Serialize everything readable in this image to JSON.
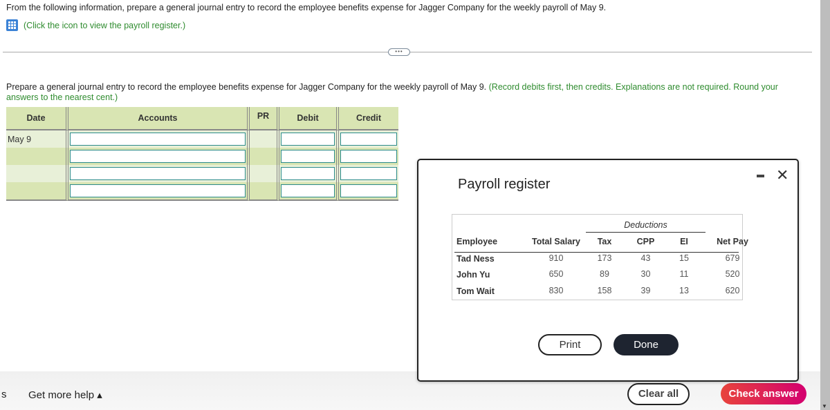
{
  "question": {
    "intro": "From the following information, prepare a general journal entry to record the employee benefits expense for Jagger Company for the weekly payroll of May 9.",
    "register_link": "(Click the icon to view the payroll register.)",
    "more_label": "•••",
    "prompt": "Prepare a general journal entry to record the employee benefits expense for Jagger Company for the weekly payroll of May 9.",
    "instructions": "(Record debits first, then credits. Explanations are not required. Round your answers to the nearest cent.)"
  },
  "journal": {
    "headers": {
      "date": "Date",
      "accounts": "Accounts",
      "pr": "PR",
      "debit": "Debit",
      "credit": "Credit"
    },
    "rows": [
      {
        "date": "May 9",
        "account": "",
        "debit": "",
        "credit": ""
      },
      {
        "date": "",
        "account": "",
        "debit": "",
        "credit": ""
      },
      {
        "date": "",
        "account": "",
        "debit": "",
        "credit": ""
      },
      {
        "date": "",
        "account": "",
        "debit": "",
        "credit": ""
      }
    ]
  },
  "modal": {
    "title": "Payroll register",
    "close_glyph": "✕",
    "register": {
      "group_header": "Deductions",
      "headers": [
        "Employee",
        "Total Salary",
        "Tax",
        "CPP",
        "EI",
        "Net Pay"
      ],
      "rows": [
        [
          "Tad Ness",
          "910",
          "173",
          "43",
          "15",
          "679"
        ],
        [
          "John Yu",
          "650",
          "89",
          "30",
          "11",
          "520"
        ],
        [
          "Tom Wait",
          "830",
          "158",
          "39",
          "13",
          "620"
        ]
      ]
    },
    "print_label": "Print",
    "done_label": "Done"
  },
  "footer": {
    "partial_label": "s",
    "help_label": "Get more help ▴",
    "clear_label": "Clear all",
    "check_label": "Check answer"
  }
}
